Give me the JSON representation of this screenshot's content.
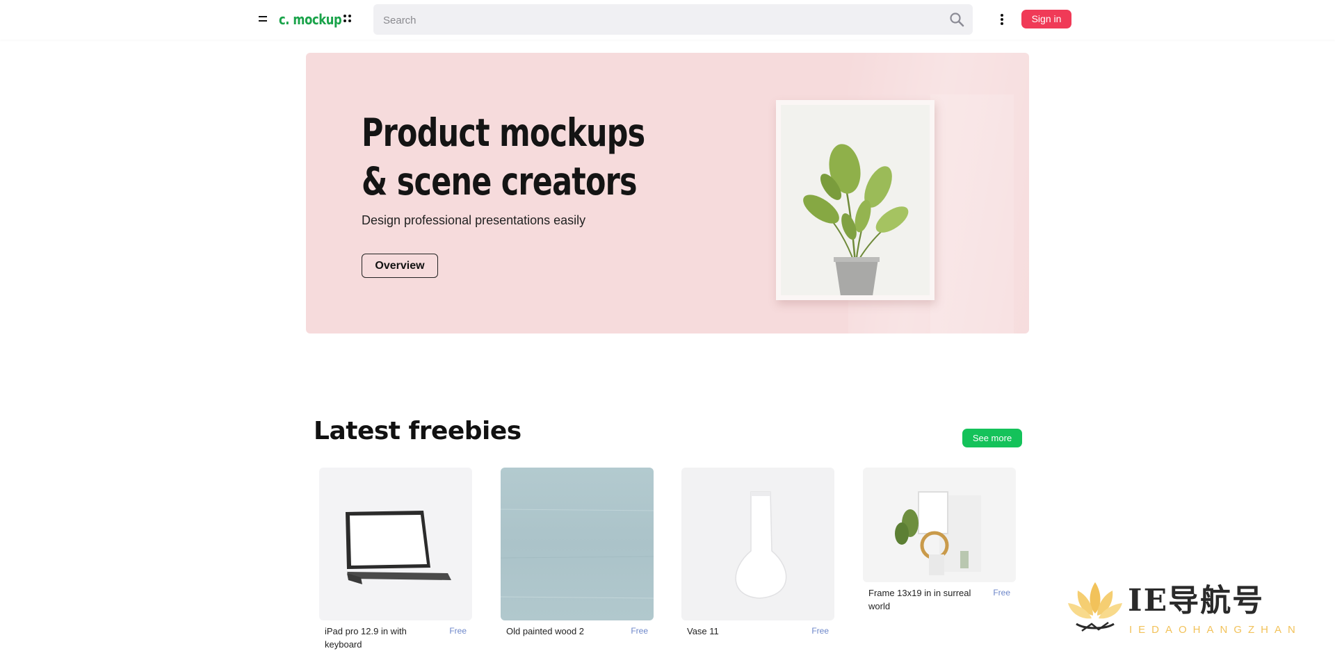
{
  "header": {
    "logo_text": "c. mockup",
    "search_placeholder": "Search",
    "signin_label": "Sign in",
    "brand_color": "#1aa34a",
    "signin_color": "#f03a57"
  },
  "hero": {
    "title_line1": "Product mockups",
    "title_line2": "& scene creators",
    "subtitle": "Design professional presentations easily",
    "overview_label": "Overview",
    "background_color": "#f6dbdc"
  },
  "freebies": {
    "title": "Latest freebies",
    "see_more_label": "See more",
    "see_more_color": "#14c25a",
    "items": [
      {
        "title": "iPad pro 12.9 in with keyboard",
        "price": "Free"
      },
      {
        "title": "Old painted wood 2",
        "price": "Free"
      },
      {
        "title": "Vase 11",
        "price": "Free"
      },
      {
        "title": "Frame 13x19 in in surreal world",
        "price": "Free"
      }
    ]
  },
  "watermark": {
    "text": "IE导航号",
    "subtext": "IEDAOHANGZHAN"
  }
}
